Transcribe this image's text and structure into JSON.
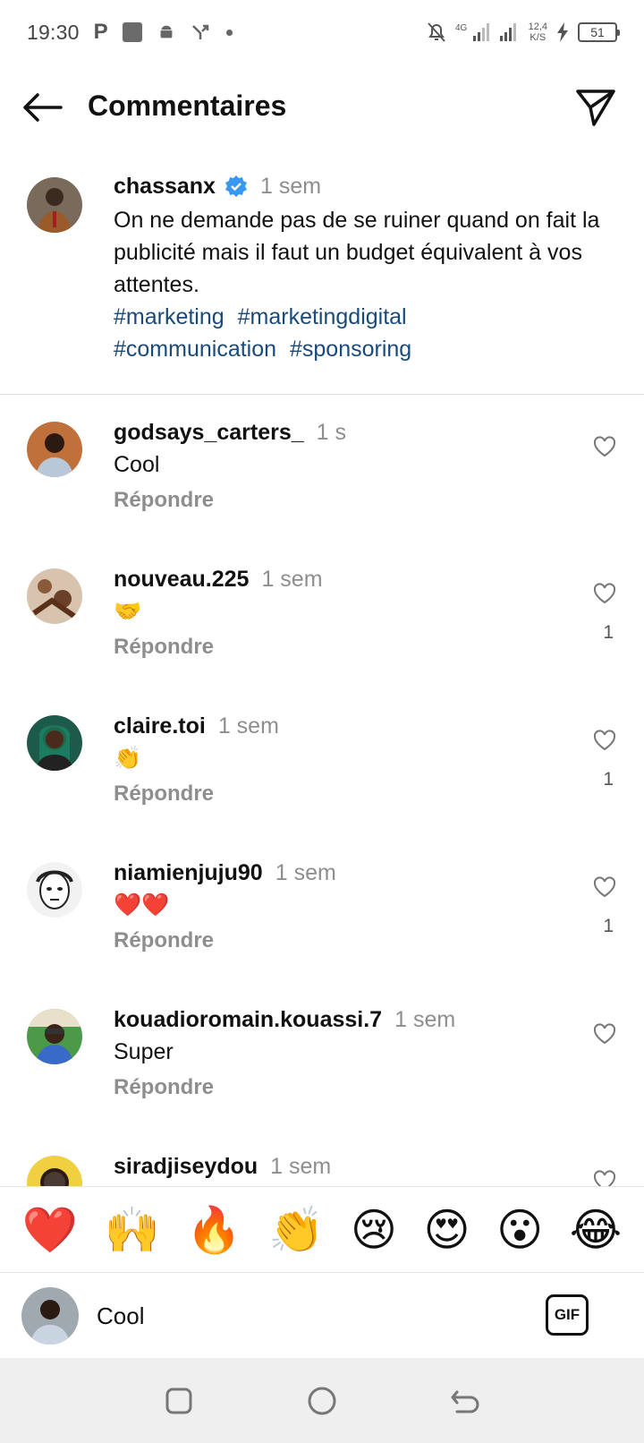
{
  "status_bar": {
    "time": "19:30",
    "speed_value": "12,4",
    "speed_unit": "K/S",
    "battery": "51",
    "network": "4G"
  },
  "header": {
    "title": "Commentaires"
  },
  "caption": {
    "username": "chassanx",
    "time": "1 sem",
    "text": "On ne demande pas de se ruiner quand on fait la publicité mais il faut un budget équivalent à vos attentes.",
    "hashtags": [
      "#marketing",
      "#marketingdigital",
      "#communication",
      "#sponsoring"
    ]
  },
  "comments": [
    {
      "username": "godsays_carters_",
      "time": "1 s",
      "text": "Cool",
      "reply": "Répondre",
      "likes": ""
    },
    {
      "username": "nouveau.225",
      "time": "1 sem",
      "text": "🤝",
      "reply": "Répondre",
      "likes": "1"
    },
    {
      "username": "claire.toi",
      "time": "1 sem",
      "text": "👏",
      "reply": "Répondre",
      "likes": "1"
    },
    {
      "username": "niamienjuju90",
      "time": "1 sem",
      "text": "❤️❤️",
      "reply": "Répondre",
      "likes": "1"
    },
    {
      "username": "kouadioromain.kouassi.7",
      "time": "1 sem",
      "text": "Super",
      "reply": "Répondre",
      "likes": ""
    },
    {
      "username": "siradjiseydou",
      "time": "1 sem",
      "text": "",
      "reply": "",
      "likes": ""
    }
  ],
  "reactions": [
    "❤️",
    "🙌",
    "🔥",
    "👏",
    "😢",
    "😍",
    "😮",
    "😂"
  ],
  "composer": {
    "value": "Cool",
    "gif_label": "GIF"
  },
  "colors": {
    "hashtag": "#1a4a7a",
    "verified": "#3897f0",
    "muted": "#8e8e8e",
    "navbar": "#efefef"
  }
}
